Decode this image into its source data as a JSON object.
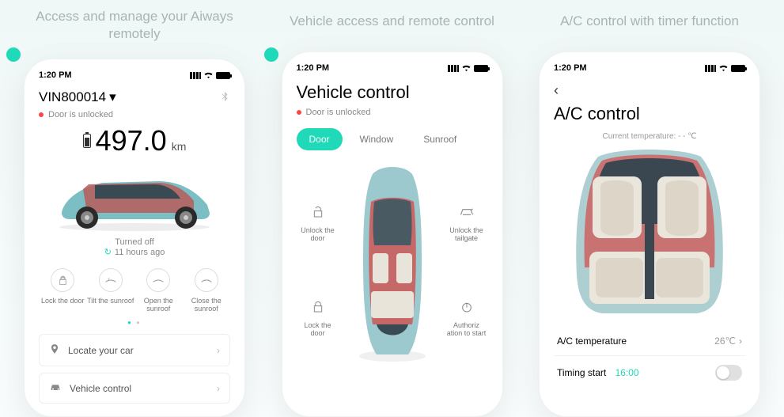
{
  "panels": [
    {
      "title": "Access and manage your Aiways remotely"
    },
    {
      "title": "Vehicle access and remote control"
    },
    {
      "title": "A/C control with timer function"
    }
  ],
  "statusbar": {
    "time": "1:20 PM"
  },
  "s1": {
    "vin": "VIN800014",
    "door_status": "Door is unlocked",
    "range_value": "497.0",
    "range_unit": "km",
    "power_state": "Turned off",
    "last_update": "11 hours ago",
    "actions": [
      {
        "name": "lock-door",
        "label": "Lock the door"
      },
      {
        "name": "tilt-sunroof",
        "label": "Tilt the sunroof"
      },
      {
        "name": "open-sunroof",
        "label": "Open the sunroof"
      },
      {
        "name": "close-sunroof",
        "label": "Close the sunroof"
      }
    ],
    "menu": [
      {
        "name": "locate-car",
        "label": "Locate your car"
      },
      {
        "name": "vehicle-control",
        "label": "Vehicle control"
      }
    ]
  },
  "s2": {
    "title": "Vehicle control",
    "door_status": "Door is unlocked",
    "tabs": [
      {
        "name": "door",
        "label": "Door",
        "active": true
      },
      {
        "name": "window",
        "label": "Window",
        "active": false
      },
      {
        "name": "sunroof",
        "label": "Sunroof",
        "active": false
      }
    ],
    "controls": {
      "unlock_door": "Unlock the door",
      "unlock_tailgate": "Unlock the tailgate",
      "lock_door": "Lock the door",
      "authorize_start": "Authoriz ation to start"
    }
  },
  "s3": {
    "title": "A/C control",
    "current_temp_label": "Current temperature: - - ℃",
    "rows": {
      "ac_temp_label": "A/C temperature",
      "ac_temp_value": "26℃",
      "timing_label": "Timing start",
      "timing_value": "16:00"
    }
  }
}
